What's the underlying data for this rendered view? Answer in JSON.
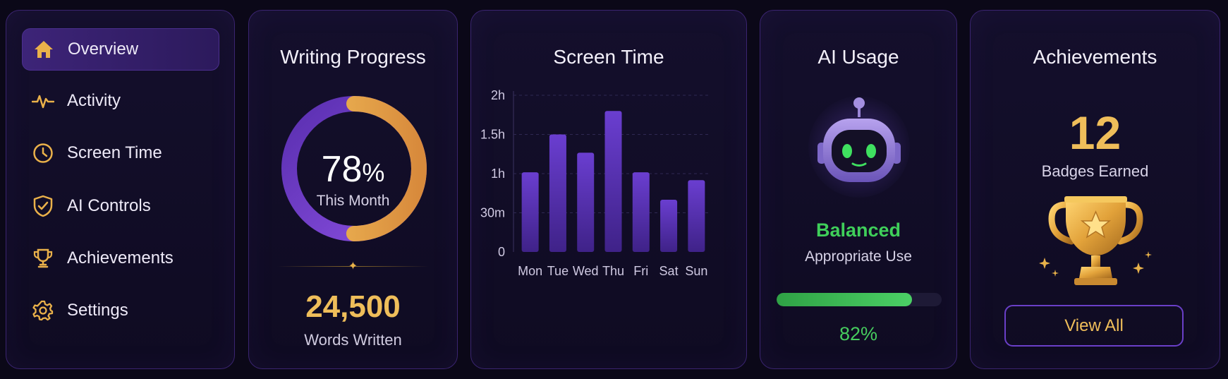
{
  "sidebar": {
    "items": [
      {
        "label": "Overview",
        "icon": "home-icon",
        "active": true
      },
      {
        "label": "Activity",
        "icon": "activity-icon",
        "active": false
      },
      {
        "label": "Screen Time",
        "icon": "clock-icon",
        "active": false
      },
      {
        "label": "AI Controls",
        "icon": "shield-check-icon",
        "active": false
      },
      {
        "label": "Achievements",
        "icon": "trophy-icon",
        "active": false
      },
      {
        "label": "Settings",
        "icon": "gear-icon",
        "active": false
      }
    ]
  },
  "writing": {
    "title": "Writing Progress",
    "percent": "78",
    "percent_sign": "%",
    "percent_label": "This Month",
    "progress_fraction": 0.78,
    "words": "24,500",
    "words_label": "Words Written"
  },
  "screen_time": {
    "title": "Screen Time"
  },
  "chart_data": {
    "type": "bar",
    "title": "Screen Time",
    "categories": [
      "Mon",
      "Tue",
      "Wed",
      "Thu",
      "Fri",
      "Sat",
      "Sun"
    ],
    "values_minutes": [
      61,
      90,
      76,
      108,
      61,
      40,
      55
    ],
    "y_ticks": [
      "0",
      "30m",
      "1h",
      "1.5h",
      "2h"
    ],
    "ylim_minutes": [
      0,
      120
    ],
    "grid": true
  },
  "ai_usage": {
    "title": "AI Usage",
    "status": "Balanced",
    "status_sub": "Appropriate Use",
    "percent_text": "82%",
    "fraction": 0.82
  },
  "achievements": {
    "title": "Achievements",
    "count": "12",
    "count_label": "Badges Earned",
    "button_label": "View All"
  },
  "colors": {
    "accent_purple": "#7b4ad6",
    "accent_gold": "#efbe5a",
    "accent_green": "#3fcf5a"
  }
}
